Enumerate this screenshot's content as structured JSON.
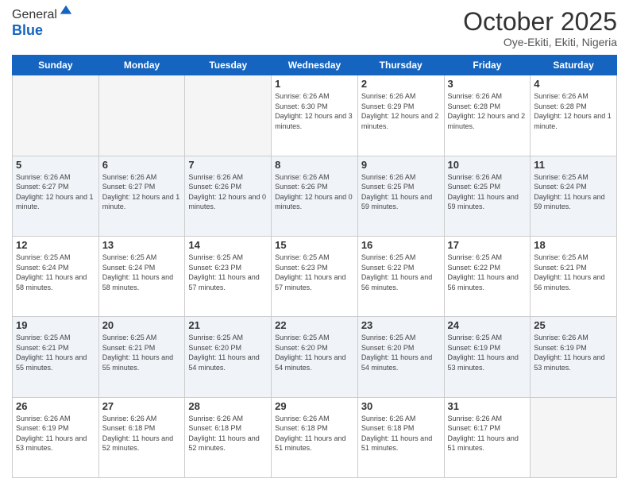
{
  "logo": {
    "general": "General",
    "blue": "Blue"
  },
  "header": {
    "month": "October 2025",
    "location": "Oye-Ekiti, Ekiti, Nigeria"
  },
  "weekdays": [
    "Sunday",
    "Monday",
    "Tuesday",
    "Wednesday",
    "Thursday",
    "Friday",
    "Saturday"
  ],
  "weeks": [
    [
      {
        "day": "",
        "sunrise": "",
        "sunset": "",
        "daylight": "",
        "empty": true
      },
      {
        "day": "",
        "sunrise": "",
        "sunset": "",
        "daylight": "",
        "empty": true
      },
      {
        "day": "",
        "sunrise": "",
        "sunset": "",
        "daylight": "",
        "empty": true
      },
      {
        "day": "1",
        "sunrise": "Sunrise: 6:26 AM",
        "sunset": "Sunset: 6:30 PM",
        "daylight": "Daylight: 12 hours and 3 minutes.",
        "empty": false
      },
      {
        "day": "2",
        "sunrise": "Sunrise: 6:26 AM",
        "sunset": "Sunset: 6:29 PM",
        "daylight": "Daylight: 12 hours and 2 minutes.",
        "empty": false
      },
      {
        "day": "3",
        "sunrise": "Sunrise: 6:26 AM",
        "sunset": "Sunset: 6:28 PM",
        "daylight": "Daylight: 12 hours and 2 minutes.",
        "empty": false
      },
      {
        "day": "4",
        "sunrise": "Sunrise: 6:26 AM",
        "sunset": "Sunset: 6:28 PM",
        "daylight": "Daylight: 12 hours and 1 minute.",
        "empty": false
      }
    ],
    [
      {
        "day": "5",
        "sunrise": "Sunrise: 6:26 AM",
        "sunset": "Sunset: 6:27 PM",
        "daylight": "Daylight: 12 hours and 1 minute.",
        "empty": false
      },
      {
        "day": "6",
        "sunrise": "Sunrise: 6:26 AM",
        "sunset": "Sunset: 6:27 PM",
        "daylight": "Daylight: 12 hours and 1 minute.",
        "empty": false
      },
      {
        "day": "7",
        "sunrise": "Sunrise: 6:26 AM",
        "sunset": "Sunset: 6:26 PM",
        "daylight": "Daylight: 12 hours and 0 minutes.",
        "empty": false
      },
      {
        "day": "8",
        "sunrise": "Sunrise: 6:26 AM",
        "sunset": "Sunset: 6:26 PM",
        "daylight": "Daylight: 12 hours and 0 minutes.",
        "empty": false
      },
      {
        "day": "9",
        "sunrise": "Sunrise: 6:26 AM",
        "sunset": "Sunset: 6:25 PM",
        "daylight": "Daylight: 11 hours and 59 minutes.",
        "empty": false
      },
      {
        "day": "10",
        "sunrise": "Sunrise: 6:26 AM",
        "sunset": "Sunset: 6:25 PM",
        "daylight": "Daylight: 11 hours and 59 minutes.",
        "empty": false
      },
      {
        "day": "11",
        "sunrise": "Sunrise: 6:25 AM",
        "sunset": "Sunset: 6:24 PM",
        "daylight": "Daylight: 11 hours and 59 minutes.",
        "empty": false
      }
    ],
    [
      {
        "day": "12",
        "sunrise": "Sunrise: 6:25 AM",
        "sunset": "Sunset: 6:24 PM",
        "daylight": "Daylight: 11 hours and 58 minutes.",
        "empty": false
      },
      {
        "day": "13",
        "sunrise": "Sunrise: 6:25 AM",
        "sunset": "Sunset: 6:24 PM",
        "daylight": "Daylight: 11 hours and 58 minutes.",
        "empty": false
      },
      {
        "day": "14",
        "sunrise": "Sunrise: 6:25 AM",
        "sunset": "Sunset: 6:23 PM",
        "daylight": "Daylight: 11 hours and 57 minutes.",
        "empty": false
      },
      {
        "day": "15",
        "sunrise": "Sunrise: 6:25 AM",
        "sunset": "Sunset: 6:23 PM",
        "daylight": "Daylight: 11 hours and 57 minutes.",
        "empty": false
      },
      {
        "day": "16",
        "sunrise": "Sunrise: 6:25 AM",
        "sunset": "Sunset: 6:22 PM",
        "daylight": "Daylight: 11 hours and 56 minutes.",
        "empty": false
      },
      {
        "day": "17",
        "sunrise": "Sunrise: 6:25 AM",
        "sunset": "Sunset: 6:22 PM",
        "daylight": "Daylight: 11 hours and 56 minutes.",
        "empty": false
      },
      {
        "day": "18",
        "sunrise": "Sunrise: 6:25 AM",
        "sunset": "Sunset: 6:21 PM",
        "daylight": "Daylight: 11 hours and 56 minutes.",
        "empty": false
      }
    ],
    [
      {
        "day": "19",
        "sunrise": "Sunrise: 6:25 AM",
        "sunset": "Sunset: 6:21 PM",
        "daylight": "Daylight: 11 hours and 55 minutes.",
        "empty": false
      },
      {
        "day": "20",
        "sunrise": "Sunrise: 6:25 AM",
        "sunset": "Sunset: 6:21 PM",
        "daylight": "Daylight: 11 hours and 55 minutes.",
        "empty": false
      },
      {
        "day": "21",
        "sunrise": "Sunrise: 6:25 AM",
        "sunset": "Sunset: 6:20 PM",
        "daylight": "Daylight: 11 hours and 54 minutes.",
        "empty": false
      },
      {
        "day": "22",
        "sunrise": "Sunrise: 6:25 AM",
        "sunset": "Sunset: 6:20 PM",
        "daylight": "Daylight: 11 hours and 54 minutes.",
        "empty": false
      },
      {
        "day": "23",
        "sunrise": "Sunrise: 6:25 AM",
        "sunset": "Sunset: 6:20 PM",
        "daylight": "Daylight: 11 hours and 54 minutes.",
        "empty": false
      },
      {
        "day": "24",
        "sunrise": "Sunrise: 6:25 AM",
        "sunset": "Sunset: 6:19 PM",
        "daylight": "Daylight: 11 hours and 53 minutes.",
        "empty": false
      },
      {
        "day": "25",
        "sunrise": "Sunrise: 6:26 AM",
        "sunset": "Sunset: 6:19 PM",
        "daylight": "Daylight: 11 hours and 53 minutes.",
        "empty": false
      }
    ],
    [
      {
        "day": "26",
        "sunrise": "Sunrise: 6:26 AM",
        "sunset": "Sunset: 6:19 PM",
        "daylight": "Daylight: 11 hours and 53 minutes.",
        "empty": false
      },
      {
        "day": "27",
        "sunrise": "Sunrise: 6:26 AM",
        "sunset": "Sunset: 6:18 PM",
        "daylight": "Daylight: 11 hours and 52 minutes.",
        "empty": false
      },
      {
        "day": "28",
        "sunrise": "Sunrise: 6:26 AM",
        "sunset": "Sunset: 6:18 PM",
        "daylight": "Daylight: 11 hours and 52 minutes.",
        "empty": false
      },
      {
        "day": "29",
        "sunrise": "Sunrise: 6:26 AM",
        "sunset": "Sunset: 6:18 PM",
        "daylight": "Daylight: 11 hours and 51 minutes.",
        "empty": false
      },
      {
        "day": "30",
        "sunrise": "Sunrise: 6:26 AM",
        "sunset": "Sunset: 6:18 PM",
        "daylight": "Daylight: 11 hours and 51 minutes.",
        "empty": false
      },
      {
        "day": "31",
        "sunrise": "Sunrise: 6:26 AM",
        "sunset": "Sunset: 6:17 PM",
        "daylight": "Daylight: 11 hours and 51 minutes.",
        "empty": false
      },
      {
        "day": "",
        "sunrise": "",
        "sunset": "",
        "daylight": "",
        "empty": true
      }
    ]
  ]
}
